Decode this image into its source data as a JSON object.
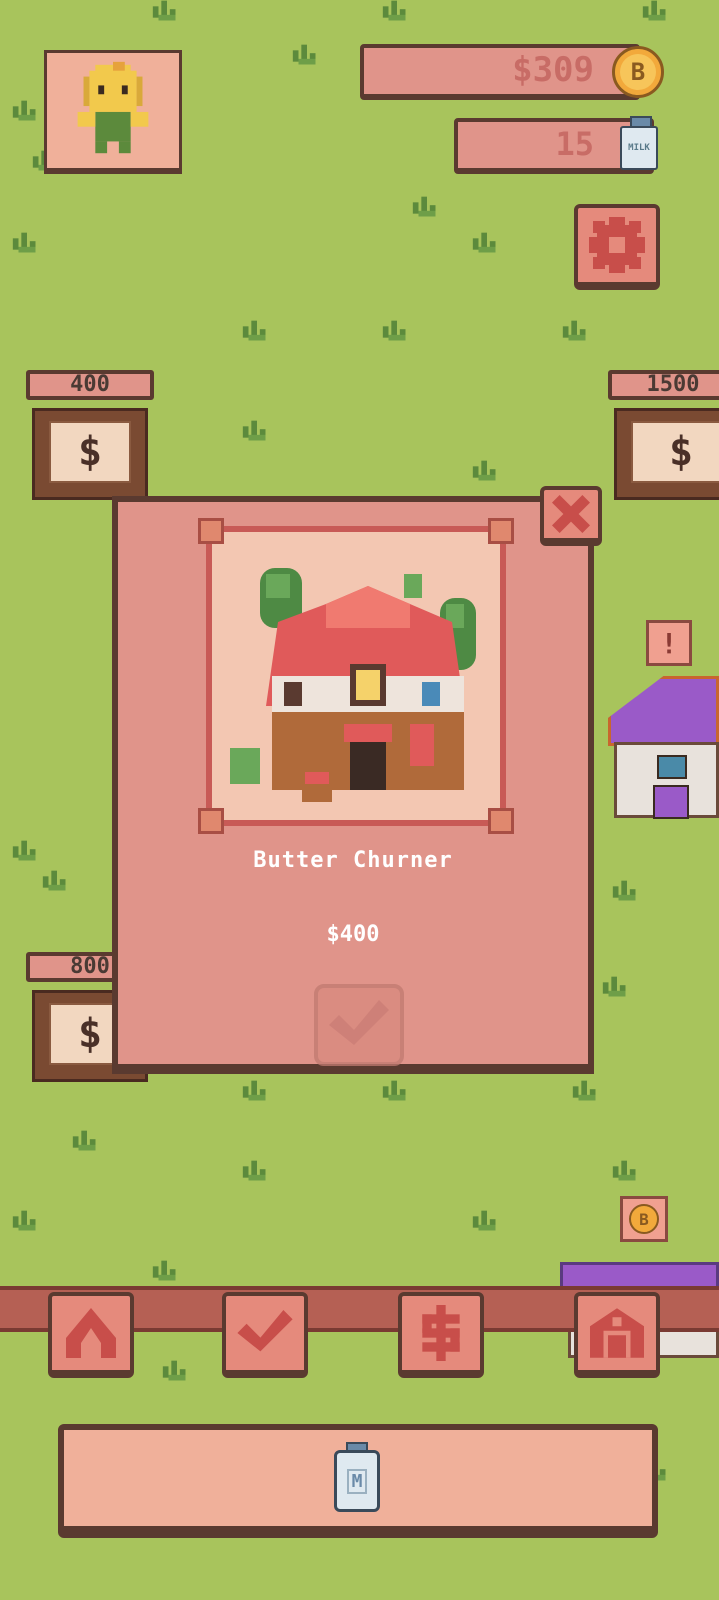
{
  "hud": {
    "money": "$309",
    "milk_count": "15",
    "coin_letter": "B",
    "milk_label": "MILK"
  },
  "signs": [
    {
      "price": "400",
      "symbol": "$"
    },
    {
      "price": "1500",
      "symbol": "$"
    },
    {
      "price": "800",
      "symbol": "$"
    }
  ],
  "modal": {
    "item_name": "Butter Churner",
    "item_price": "$400"
  },
  "bubbles": {
    "alert_symbol": "!",
    "coin_letter": "B"
  },
  "bottom_panel": {
    "jug_letter": "M"
  },
  "colors": {
    "grass": "#a8c45c",
    "panel": "#e0948a",
    "accent": "#c85a56",
    "outline": "#5a3a30"
  }
}
